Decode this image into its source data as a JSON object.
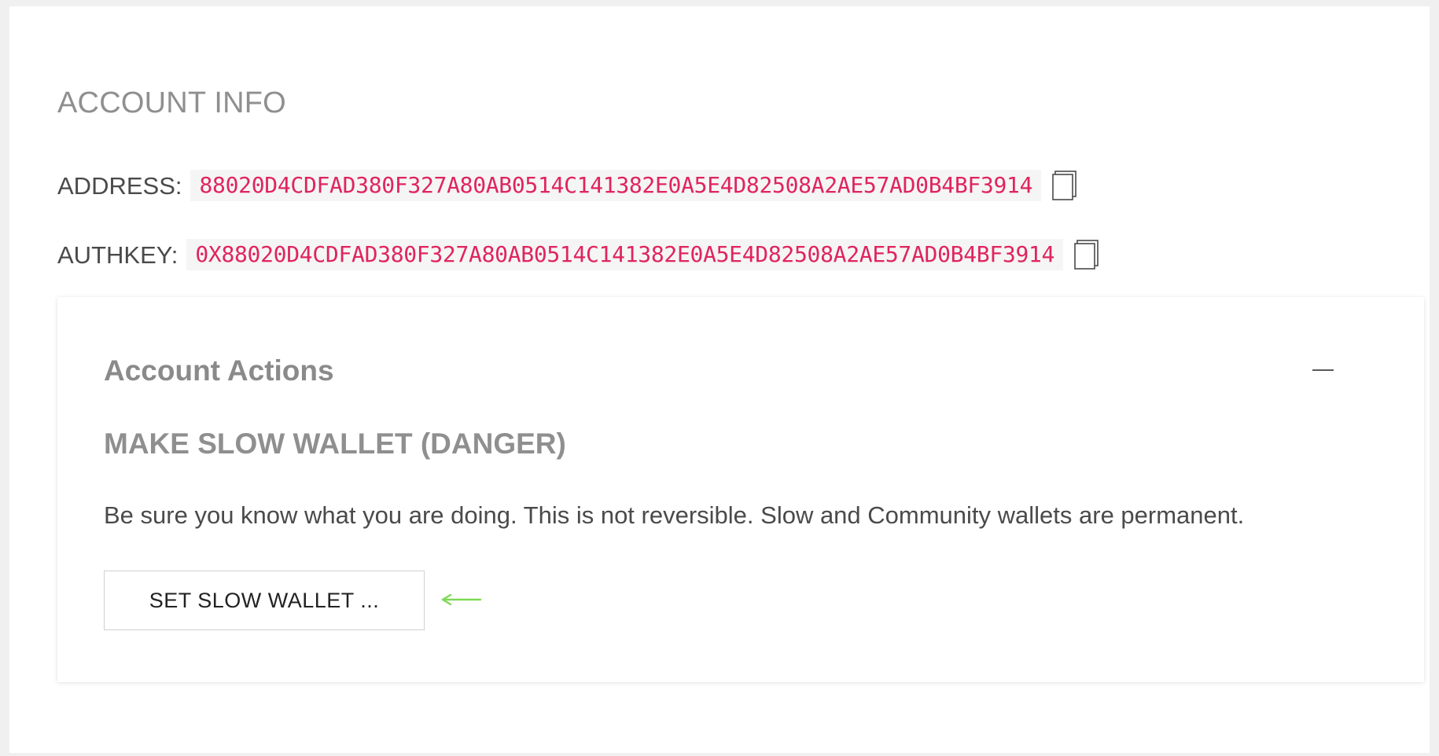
{
  "account_info": {
    "title": "ACCOUNT INFO",
    "address": {
      "label": "ADDRESS:",
      "value": "88020D4CDFAD380F327A80AB0514C141382E0A5E4D82508A2AE57AD0B4BF3914",
      "copy_icon": "copy-icon"
    },
    "authkey": {
      "label": "AUTHKEY:",
      "value": "0X88020D4CDFAD380F327A80AB0514C141382E0A5E4D82508A2AE57AD0B4BF3914",
      "copy_icon": "copy-icon"
    }
  },
  "account_actions": {
    "title": "Account Actions",
    "collapse_icon": "minus-icon",
    "section_title": "MAKE SLOW WALLET (DANGER)",
    "warning": "Be sure you know what you are doing. This is not reversible. Slow and Community wallets are permanent.",
    "button_label": "SET SLOW WALLET ...",
    "annotation_icon": "arrow-left-icon"
  },
  "colors": {
    "value_text": "#e0245e",
    "value_bg": "#f5f5f5",
    "annotation_arrow": "#7ed957"
  }
}
